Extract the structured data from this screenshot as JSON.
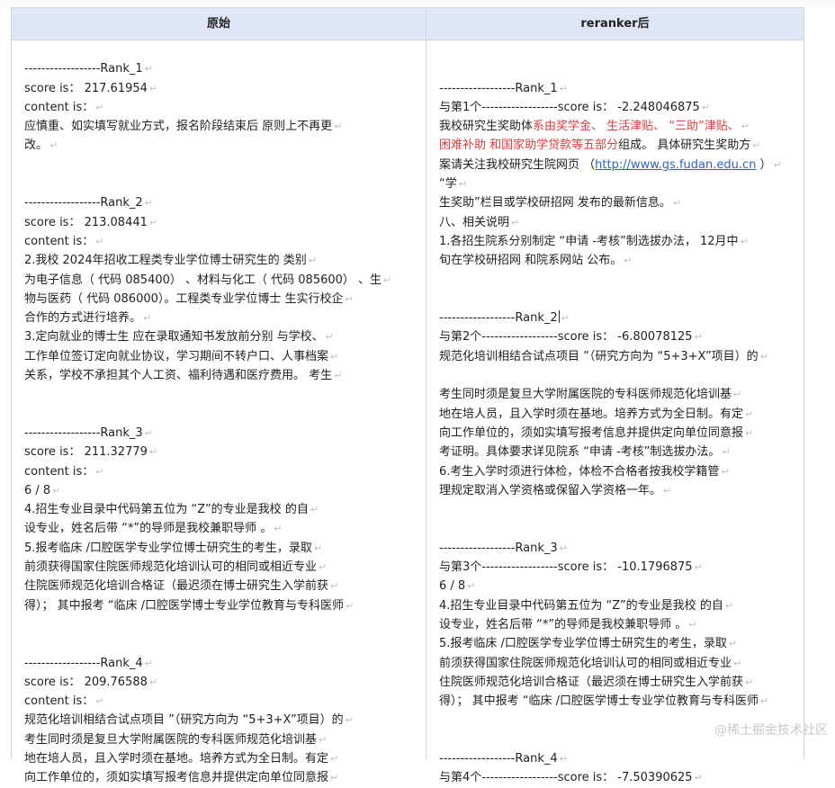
{
  "header": {
    "left_title": "原始",
    "right_title": "reranker后"
  },
  "left_lines": [
    "",
    "------------------Rank_1",
    "score is： 217.61954",
    "content is：",
    "应慎重、如实填写就业方式，报名阶段结束后 原则上不再更",
    "改。",
    "",
    "",
    "------------------Rank_2",
    "score is： 213.08441",
    "content is：",
    "2.我校 2024年招收工程类专业学位博士研究生的 类别",
    "为电子信息（ 代码 085400） 、材料与化工（ 代码 085600） 、生",
    "物与医药（ 代码 086000）。工程类专业学位博士 生实行校企",
    "合作的方式进行培养。",
    "3.定向就业的博士生 应在录取通知书发放前分别 与学校、",
    "工作单位签订定向就业协议，学习期间不转户口、人事档案",
    "关系，学校不承担其个人工资、福利待遇和医疗费用。 考生",
    "",
    "",
    "------------------Rank_3",
    "score is： 211.32779",
    "content is：",
    "6 / 8",
    "4.招生专业目录中代码第五位为 “Z”的专业是我校 的自",
    "设专业，姓名后带 “*”的导师是我校兼职导师 。",
    "5.报考临床 /口腔医学专业学位博士研究生的考生，录取",
    "前须获得国家住院医师规范化培训认可的相同或相近专业",
    "住院医师规范化培训合格证（最迟须在博士研究生入学前获",
    "得）； 其中报考 “临床 /口腔医学博士专业学位教育与专科医师",
    "",
    "",
    "------------------Rank_4",
    "score is： 209.76588",
    "content is：",
    "规范化培训相结合试点项目 ”（研究方向为 “5+3+X”项目）的",
    "考生同时须是复旦大学附属医院的专科医师规范化培训基",
    "地在培人员，且入学时须在基地。培养方式为全日制。有定",
    "向工作单位的，须如实填写报考信息并提供定向单位同意报"
  ],
  "right_lines": [
    "",
    "",
    "------------------Rank_1",
    "与第1个------------------score is： -2.248046875",
    "我校研究生奖助体系由奖学金、 生活津贴、 “三助”津贴、",
    "困难补助 和国家助学贷款等五部分组成。 具体研究生奖助方",
    "案请关注我校研究生院网页 （http://www.gs.fudan.edu.cn ）",
    "“学",
    "生奖助”栏目或学校研招网 发布的最新信息。",
    "八、相关说明",
    "1.各招生院系分别制定 “申请 -考核”制选拔办法， 12月中",
    "旬在学校研招网 和院系网站 公布。",
    "",
    "",
    "------------------Rank_2",
    "与第2个------------------score is： -6.80078125",
    "规范化培训相结合试点项目 ”（研究方向为 “5+3+X”项目）的",
    "",
    "考生同时须是复旦大学附属医院的专科医师规范化培训基",
    "地在培人员，且入学时须在基地。培养方式为全日制。有定",
    "向工作单位的，须如实填写报考信息并提供定向单位同意报",
    "考证明。具体要求详见院系 “申请 -考核”制选拔办法。",
    "6.考生入学时须进行体检，体检不合格者按我校学籍管",
    "理规定取消入学资格或保留入学资格一年。",
    "",
    "",
    "------------------Rank_3",
    "与第3个------------------score is： -10.1796875",
    "6 / 8",
    "4.招生专业目录中代码第五位为 “Z”的专业是我校 的自",
    "设专业，姓名后带 “*”的导师是我校兼职导师 。",
    "5.报考临床 /口腔医学专业学位博士研究生的考生，录取",
    "前须获得国家住院医师规范化培训认可的相同或相近专业",
    "住院医师规范化培训合格证（最迟须在博士研究生入学前获",
    "得）； 其中报考 “临床 /口腔医学博士专业学位教育与专科医师",
    "",
    "",
    "------------------Rank_4",
    "与第4个------------------score is： -7.50390625"
  ],
  "right_line4_parts": {
    "before": "我校研究生奖助体",
    "red": "系由奖学金、 生活津贴、 “三助”津贴、"
  },
  "right_line5_parts": {
    "red": "困难补助 和国家助学贷款等五部分",
    "after": "组成。 具体研究生奖助方"
  },
  "right_line6_parts": {
    "before": "案请关注我校研究生院网页 （",
    "link": "http://www.gs.fudan.edu.cn",
    "after": " ）"
  },
  "watermark": "@稀土掘金技术社区",
  "paragraph_mark": "↵",
  "colors": {
    "header_bg": "#dfe7f7",
    "border": "#cfd6e4",
    "highlight_red": "#e03b3b",
    "link_blue": "#2b62c9"
  }
}
